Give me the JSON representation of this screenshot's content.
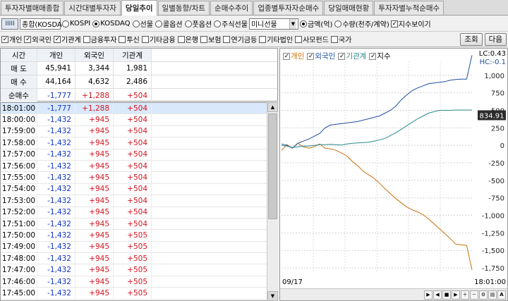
{
  "tabs": [
    "투자자별매매종합",
    "시간대별투자자",
    "당일추이",
    "일별동향/차트",
    "순매수추이",
    "업종별투자자순매수",
    "당일매매현황",
    "투자자별누적순매수"
  ],
  "active_tab": 2,
  "toolbar": {
    "code_icon": "IIIII",
    "code_label": "종합(KOSDAQ",
    "markets": [
      {
        "label": "KOSPI",
        "on": false
      },
      {
        "label": "KOSDAQ",
        "on": true
      },
      {
        "label": "선물",
        "on": false
      },
      {
        "label": "콜옵션",
        "on": false
      },
      {
        "label": "풋옵션",
        "on": false
      },
      {
        "label": "주식선물",
        "on": false
      }
    ],
    "combo_value": "미니선물",
    "units": [
      {
        "label": "금액(억)",
        "on": true
      },
      {
        "label": "수량(천주/계약)",
        "on": false
      }
    ],
    "show_index": "지수보이기"
  },
  "filters": [
    {
      "label": "개인",
      "on": true
    },
    {
      "label": "외국인",
      "on": true
    },
    {
      "label": "기관계",
      "on": true
    },
    {
      "label": "금융투자",
      "on": false
    },
    {
      "label": "투신",
      "on": false
    },
    {
      "label": "기타금융",
      "on": false
    },
    {
      "label": "은행",
      "on": false
    },
    {
      "label": "보험",
      "on": false
    },
    {
      "label": "연기금등",
      "on": false
    },
    {
      "label": "기타법인",
      "on": false
    },
    {
      "label": "사모펀드",
      "on": false
    },
    {
      "label": "국가",
      "on": false
    }
  ],
  "buttons": {
    "query": "조회",
    "next": "다음"
  },
  "summary": {
    "headers": [
      "시간",
      "개인",
      "외국인",
      "기관계"
    ],
    "rows": [
      {
        "label": "매 도",
        "v": [
          "45,941",
          "3,344",
          "1,981"
        ]
      },
      {
        "label": "매 수",
        "v": [
          "44,164",
          "4,632",
          "2,486"
        ]
      },
      {
        "label": "순매수",
        "v": [
          "-1,777",
          "+1,288",
          "+504"
        ]
      }
    ]
  },
  "table": [
    [
      "18:01:00",
      "-1,777",
      "+1,288",
      "+504"
    ],
    [
      "18:00:00",
      "-1,432",
      "+945",
      "+504"
    ],
    [
      "17:59:00",
      "-1,432",
      "+945",
      "+504"
    ],
    [
      "17:58:00",
      "-1,432",
      "+945",
      "+504"
    ],
    [
      "17:57:00",
      "-1,432",
      "+945",
      "+504"
    ],
    [
      "17:56:00",
      "-1,432",
      "+945",
      "+504"
    ],
    [
      "17:55:00",
      "-1,432",
      "+945",
      "+504"
    ],
    [
      "17:54:00",
      "-1,432",
      "+945",
      "+504"
    ],
    [
      "17:53:00",
      "-1,432",
      "+945",
      "+504"
    ],
    [
      "17:52:00",
      "-1,432",
      "+945",
      "+504"
    ],
    [
      "17:51:00",
      "-1,432",
      "+945",
      "+504"
    ],
    [
      "17:50:00",
      "-1,432",
      "+945",
      "+505"
    ],
    [
      "17:49:00",
      "-1,432",
      "+945",
      "+505"
    ],
    [
      "17:48:00",
      "-1,432",
      "+945",
      "+505"
    ],
    [
      "17:47:00",
      "-1,432",
      "+945",
      "+505"
    ],
    [
      "17:46:00",
      "-1,432",
      "+945",
      "+505"
    ],
    [
      "17:45:00",
      "-1,432",
      "+945",
      "+505"
    ]
  ],
  "chart_data": {
    "type": "line",
    "legend": [
      "개인",
      "외국인",
      "기관계",
      "지수"
    ],
    "series_colors": {
      "개인": "#c8700a",
      "외국인": "#1e4f9e",
      "기관계": "#2c8a8c",
      "지수": "#000000"
    },
    "y_ticks": [
      "1,000",
      "750",
      "500",
      "250",
      "0",
      "-250",
      "-500",
      "-750",
      "-1,000",
      "-1,250",
      "-1,500",
      "-1,750"
    ],
    "ylim": [
      -1800,
      1200
    ],
    "lc_label": "LC:0.43",
    "hc_label": "HC:-0.1",
    "current_index": "834.91",
    "x_start_label": "09/17",
    "x_end_label": "18:01:00",
    "series": [
      {
        "name": "개인",
        "values": [
          -70,
          10,
          -40,
          30,
          -20,
          -40,
          -20,
          20,
          -40,
          -50,
          -70,
          -110,
          -150,
          -230,
          -290,
          -370,
          -420,
          -470,
          -540,
          -620,
          -690,
          -760,
          -820,
          -880,
          -920,
          -950,
          -990,
          -1050,
          -1120,
          -1190,
          -1260,
          -1330,
          -1410,
          -1420,
          -1430,
          -1777
        ]
      },
      {
        "name": "외국인",
        "values": [
          20,
          0,
          -40,
          30,
          60,
          90,
          130,
          170,
          250,
          290,
          300,
          310,
          320,
          330,
          340,
          360,
          380,
          400,
          420,
          460,
          500,
          560,
          650,
          720,
          780,
          820,
          850,
          880,
          890,
          900,
          910,
          930,
          940,
          945,
          945,
          1288
        ]
      },
      {
        "name": "기관계",
        "values": [
          0,
          -10,
          -30,
          -20,
          -10,
          -10,
          0,
          10,
          10,
          15,
          10,
          5,
          20,
          30,
          35,
          40,
          45,
          60,
          80,
          100,
          140,
          180,
          230,
          280,
          330,
          380,
          420,
          460,
          480,
          500,
          500,
          500,
          504,
          504,
          504,
          504
        ]
      }
    ]
  }
}
